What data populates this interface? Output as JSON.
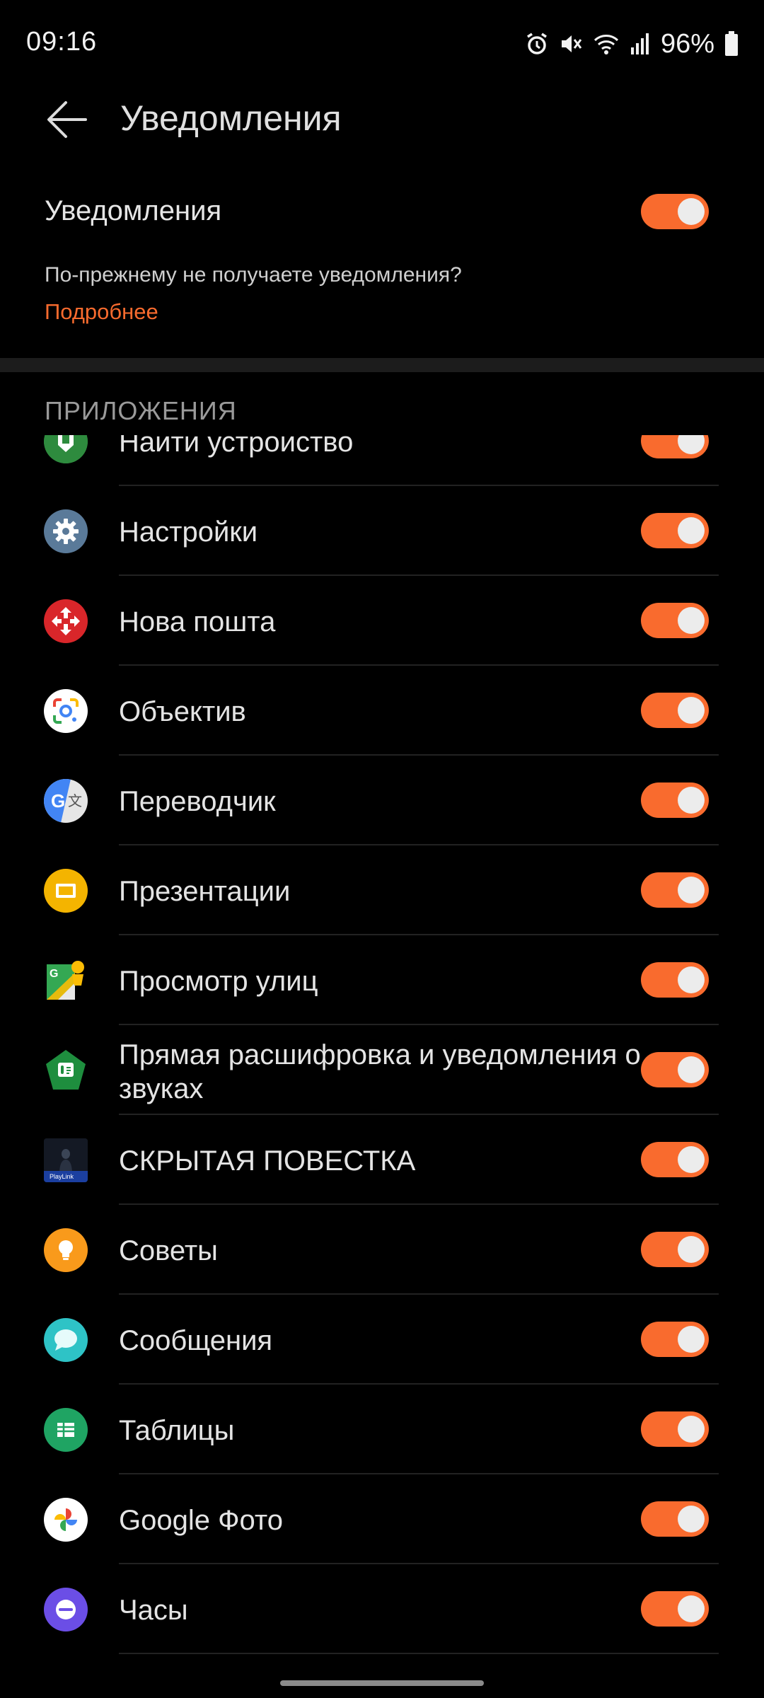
{
  "status_bar": {
    "time": "09:16",
    "battery_percent": "96%",
    "icons": [
      "alarm-icon",
      "mute-icon",
      "wifi-icon",
      "signal-icon",
      "battery-icon"
    ]
  },
  "header": {
    "back_icon": "back-arrow-icon",
    "title": "Уведомления"
  },
  "master": {
    "label": "Уведомления",
    "enabled": true
  },
  "hint": {
    "text": "По-прежнему не получаете уведомления?",
    "link": "Подробнее"
  },
  "section_title": "ПРИЛОЖЕНИЯ",
  "colors": {
    "accent": "#f96b2e",
    "background": "#000000",
    "knob": "#ececec"
  },
  "apps": [
    {
      "name": "Найти устройство",
      "icon": "find-device-icon",
      "enabled": true
    },
    {
      "name": "Настройки",
      "icon": "settings-gear-icon",
      "enabled": true
    },
    {
      "name": "Нова пошта",
      "icon": "nova-poshta-icon",
      "enabled": true
    },
    {
      "name": "Объектив",
      "icon": "lens-icon",
      "enabled": true
    },
    {
      "name": "Переводчик",
      "icon": "translate-icon",
      "enabled": true
    },
    {
      "name": "Презентации",
      "icon": "slides-icon",
      "enabled": true
    },
    {
      "name": "Просмотр улиц",
      "icon": "street-view-icon",
      "enabled": true
    },
    {
      "name": "Прямая расшифровка и уведомления о звуках",
      "icon": "live-transcribe-icon",
      "enabled": true
    },
    {
      "name": "СКРЫТАЯ ПОВЕСТКА",
      "icon": "hidden-agenda-icon",
      "enabled": true
    },
    {
      "name": "Советы",
      "icon": "tips-bulb-icon",
      "enabled": true
    },
    {
      "name": "Сообщения",
      "icon": "messages-icon",
      "enabled": true
    },
    {
      "name": "Таблицы",
      "icon": "sheets-icon",
      "enabled": true
    },
    {
      "name": "Google Фото",
      "icon": "google-photos-icon",
      "enabled": true
    },
    {
      "name": "Часы",
      "icon": "clock-icon",
      "enabled": true
    }
  ]
}
